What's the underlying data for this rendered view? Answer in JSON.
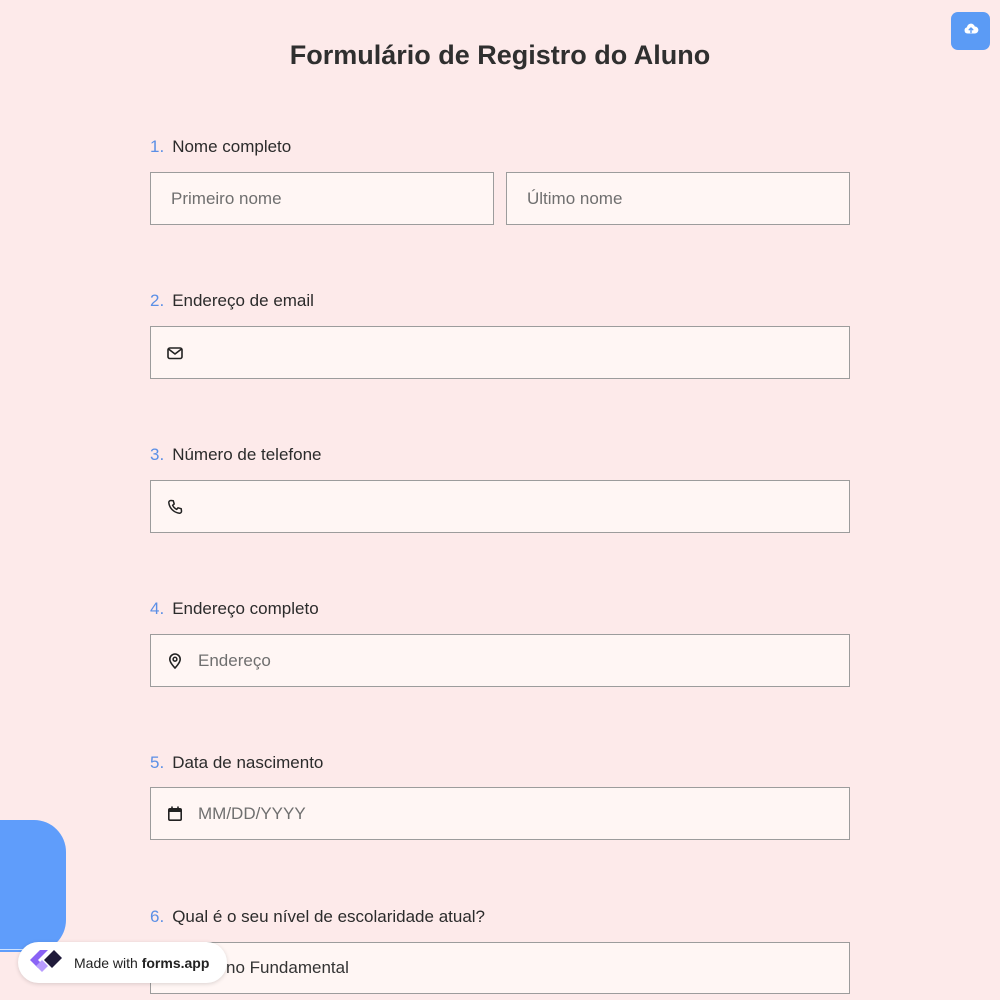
{
  "title": "Formulário de Registro do Aluno",
  "colors": {
    "background": "#fdeaea",
    "accent": "#5b8fe6",
    "field_bg": "#fff6f4"
  },
  "questions": [
    {
      "num": "1.",
      "label": "Nome completo",
      "first_placeholder": "Primeiro nome",
      "last_placeholder": "Último nome"
    },
    {
      "num": "2.",
      "label": "Endereço de email",
      "icon": "mail-icon",
      "value": ""
    },
    {
      "num": "3.",
      "label": "Número de telefone",
      "icon": "phone-icon",
      "value": ""
    },
    {
      "num": "4.",
      "label": "Endereço completo",
      "icon": "map-pin-icon",
      "placeholder": "Endereço"
    },
    {
      "num": "5.",
      "label": "Data de nascimento",
      "icon": "calendar-icon",
      "placeholder": "MM/DD/YYYY"
    },
    {
      "num": "6.",
      "label": "Qual é o seu nível de escolaridade atual?",
      "selected_value": "no Fundamental"
    }
  ],
  "toolbar": {
    "upload_icon": "cloud-upload-icon"
  },
  "badge": {
    "prefix": "Made with ",
    "brand": "forms.app",
    "logo": "forms-app-logo"
  }
}
